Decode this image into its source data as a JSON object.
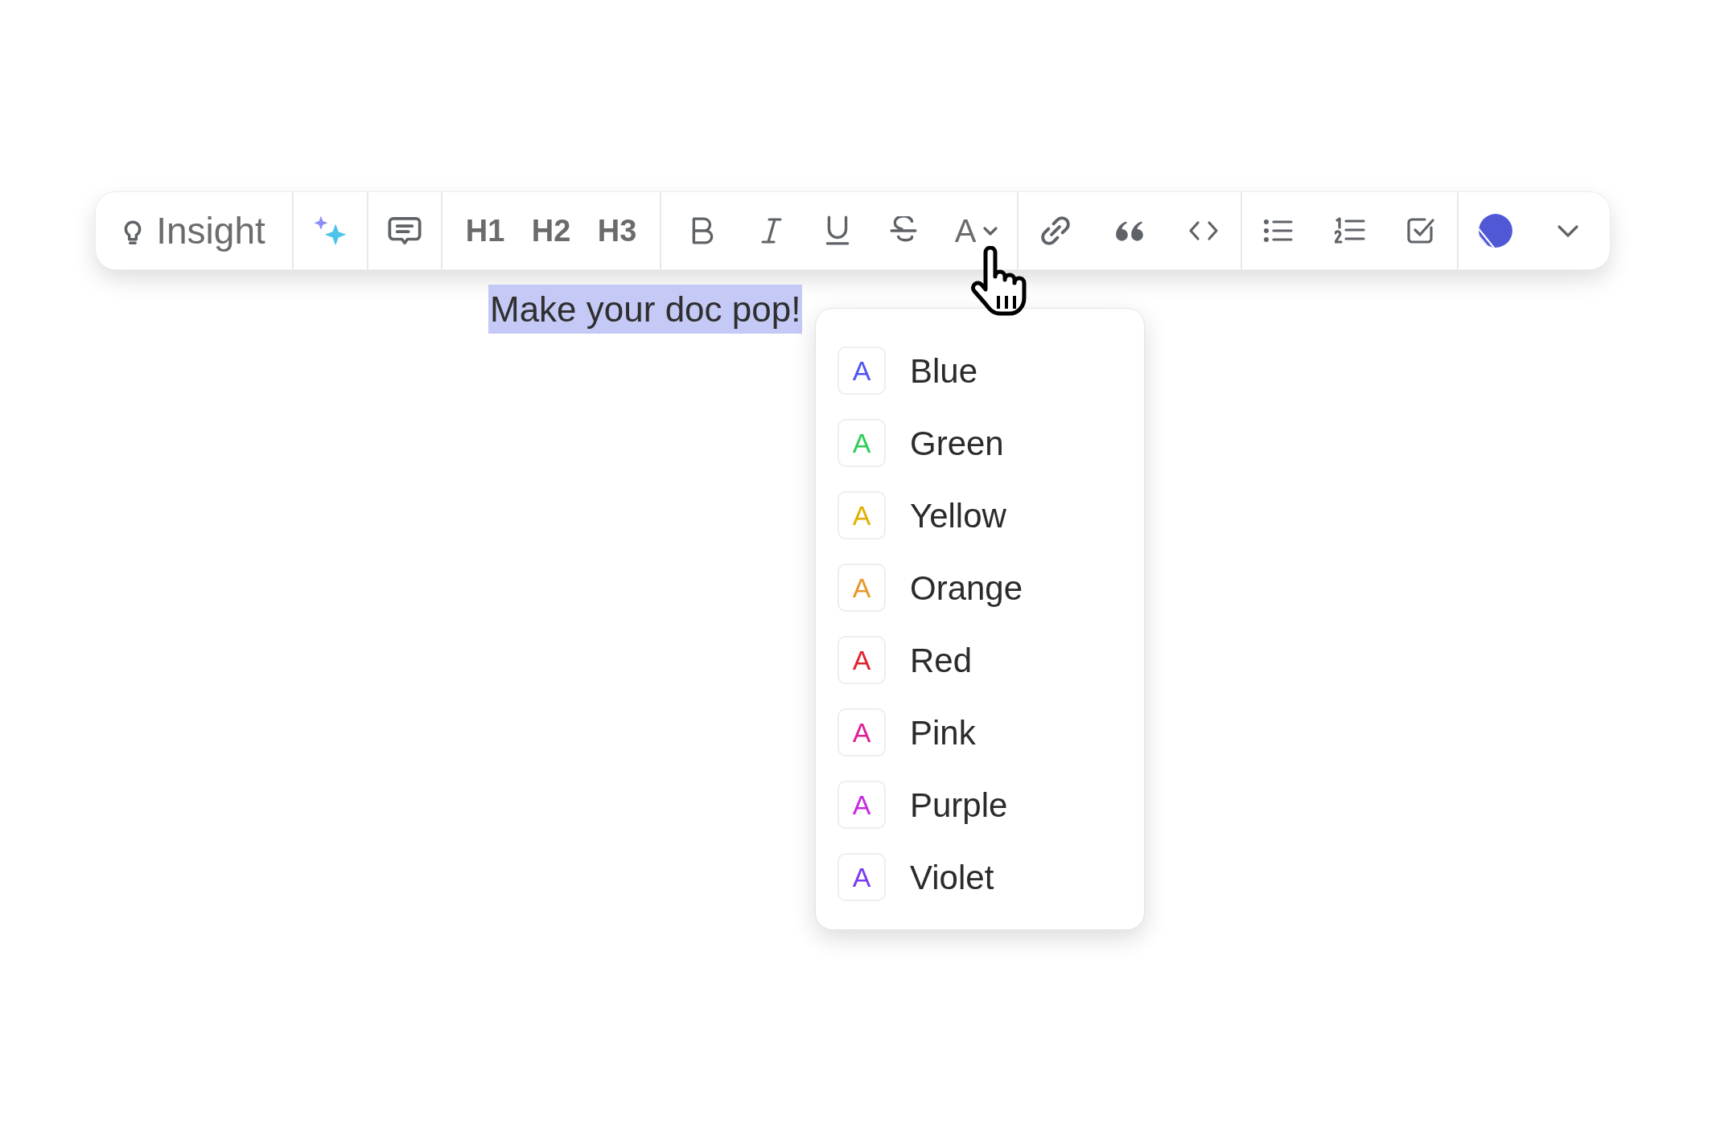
{
  "toolbar": {
    "insight_button": {
      "label": "Insight"
    },
    "headings": [
      "H1",
      "H2",
      "H3"
    ],
    "text_color_button": {
      "label": "A"
    }
  },
  "selected_text": "Make your doc pop!",
  "color_menu": [
    {
      "glyph": "A",
      "label": "Blue",
      "color": "#4f55f0"
    },
    {
      "glyph": "A",
      "label": "Green",
      "color": "#2ecc5a"
    },
    {
      "glyph": "A",
      "label": "Yellow",
      "color": "#e0b000"
    },
    {
      "glyph": "A",
      "label": "Orange",
      "color": "#e8962a"
    },
    {
      "glyph": "A",
      "label": "Red",
      "color": "#e0242b"
    },
    {
      "glyph": "A",
      "label": "Pink",
      "color": "#e0209a"
    },
    {
      "glyph": "A",
      "label": "Purple",
      "color": "#c42ae0"
    },
    {
      "glyph": "A",
      "label": "Violet",
      "color": "#7a3cf0"
    }
  ]
}
